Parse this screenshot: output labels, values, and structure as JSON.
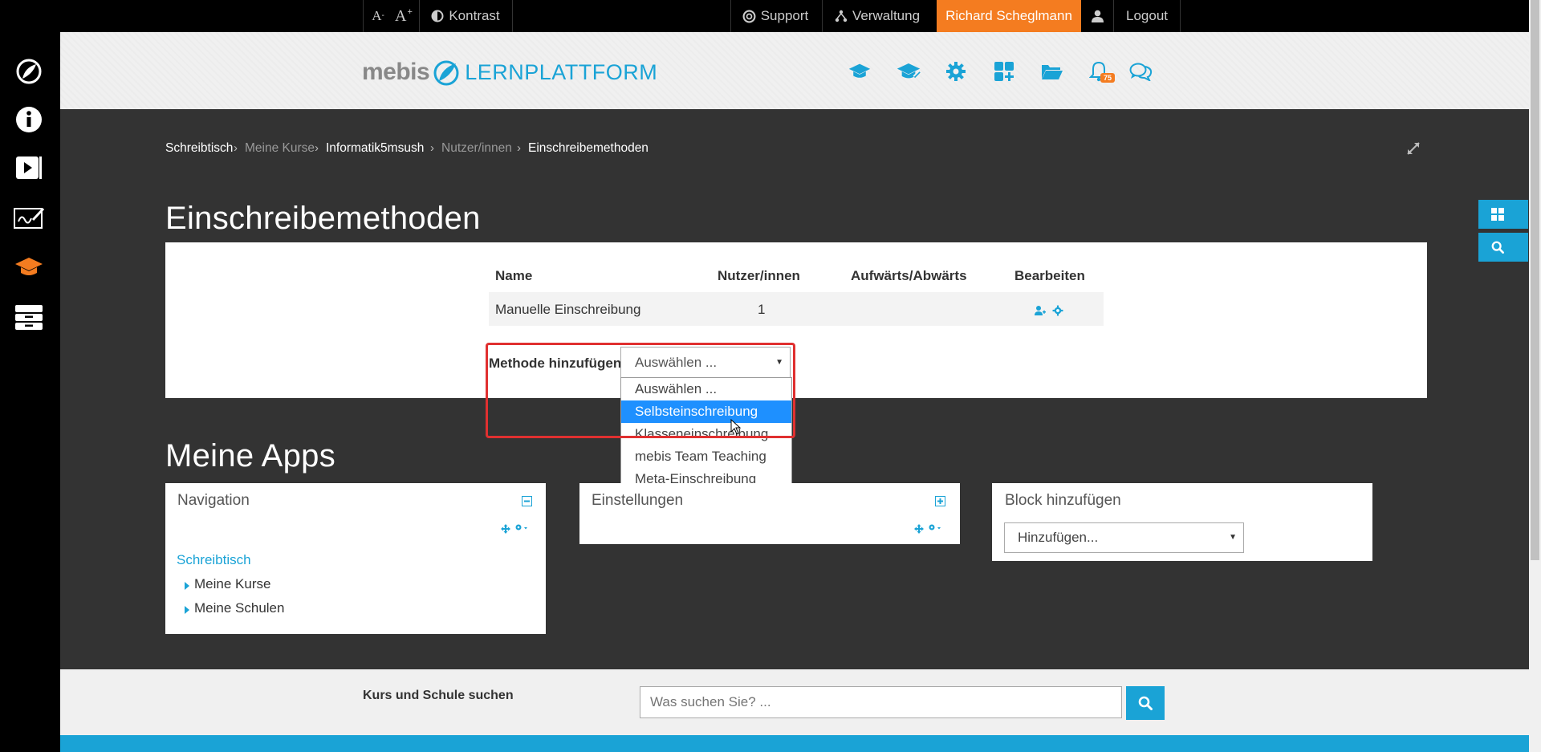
{
  "topbar": {
    "font_decrease": "A",
    "font_increase": "A",
    "contrast": "Kontrast",
    "support": "Support",
    "admin": "Verwaltung",
    "user": "Richard Scheglmann",
    "logout": "Logout"
  },
  "header": {
    "logo_word": "mebis",
    "platform": "LERNPLATTFORM",
    "notif_count": "75"
  },
  "breadcrumb": [
    "Schreibtisch",
    "Meine Kurse",
    "Informatik5msush",
    "Nutzer/innen",
    "Einschreibemethoden"
  ],
  "page": {
    "title": "Einschreibemethoden",
    "table": {
      "headers": [
        "Name",
        "Nutzer/innen",
        "Aufwärts/Abwärts",
        "Bearbeiten"
      ],
      "rows": [
        {
          "name": "Manuelle Einschreibung",
          "users": "1"
        }
      ]
    },
    "add_method_label": "Methode hinzufügen",
    "select_value": "Auswählen ...",
    "options": [
      "Auswählen ...",
      "Selbsteinschreibung",
      "Klasseneinschreibung",
      "mebis Team Teaching",
      "Meta-Einschreibung"
    ],
    "selected_option_index": 1
  },
  "apps": {
    "title": "Meine Apps",
    "navigation": {
      "title": "Navigation",
      "home": "Schreibtisch",
      "items": [
        "Meine Kurse",
        "Meine Schulen"
      ]
    },
    "settings": {
      "title": "Einstellungen"
    },
    "add_block": {
      "title": "Block hinzufügen",
      "select_value": "Hinzufügen..."
    }
  },
  "footer": {
    "label": "Kurs und Schule suchen",
    "placeholder": "Was suchen Sie? ..."
  },
  "colors": {
    "accent": "#1aa3d6",
    "user_orange": "#f47c20",
    "highlight": "#e03030",
    "selected": "#1e90ff"
  }
}
